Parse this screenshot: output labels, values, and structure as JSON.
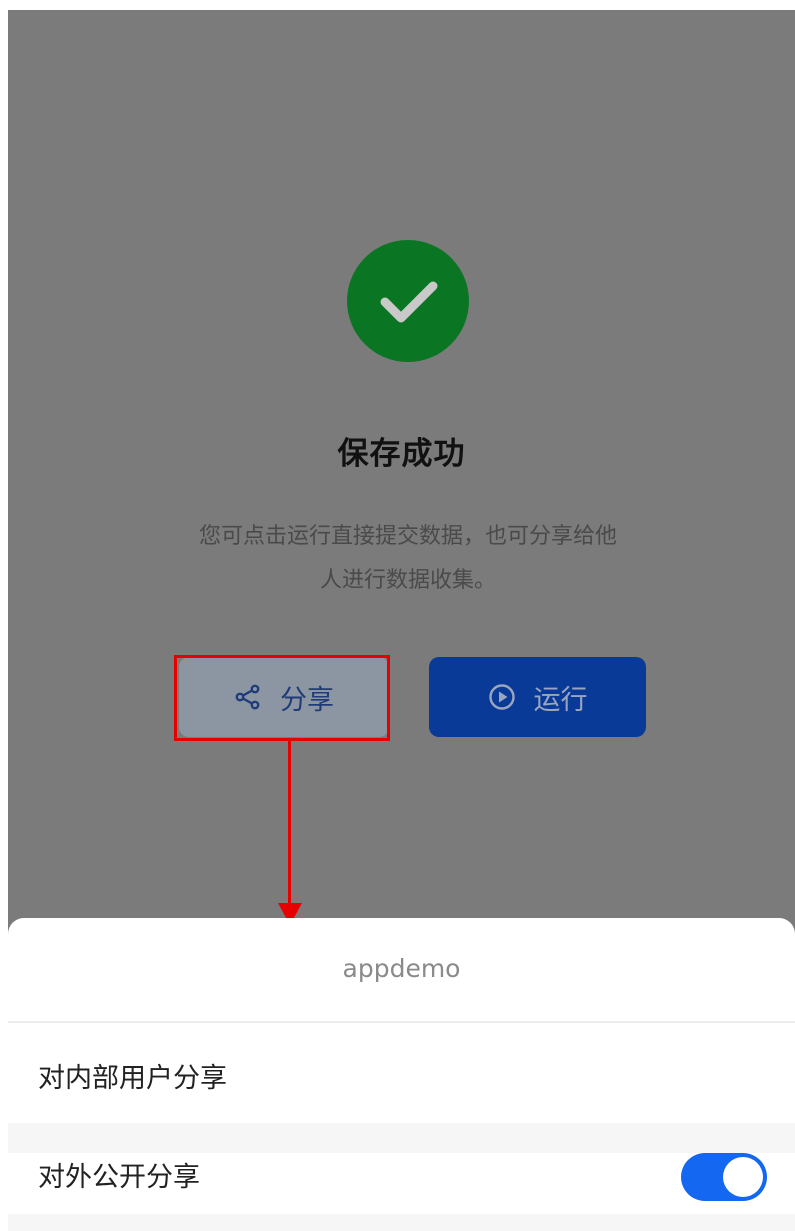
{
  "result": {
    "title": "保存成功",
    "description_line1": "您可点击运行直接提交数据，也可分享给他",
    "description_line2": "人进行数据收集。"
  },
  "actions": {
    "share_label": "分享",
    "run_label": "运行"
  },
  "share_sheet": {
    "app_name": "appdemo",
    "options": [
      {
        "label": "对内部用户分享"
      },
      {
        "label": "对外公开分享",
        "toggle_on": true
      }
    ]
  },
  "colors": {
    "success": "#0a7522",
    "primary": "#1367f0",
    "annotation": "#e60000"
  }
}
